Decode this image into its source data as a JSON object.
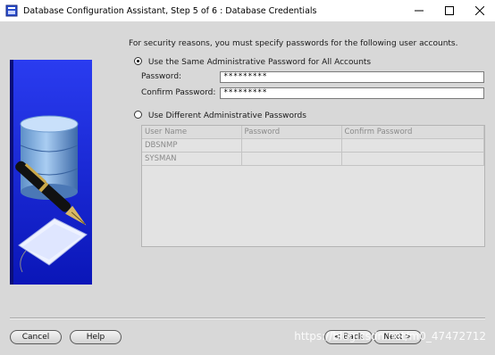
{
  "window": {
    "title": "Database Configuration Assistant, Step 5 of 6 : Database Credentials"
  },
  "content": {
    "intro": "For security reasons, you must specify passwords for the following user accounts.",
    "same_password_option": {
      "label": "Use the Same Administrative Password for All Accounts",
      "selected": true
    },
    "password_label": "Password:",
    "password_value": "*********",
    "confirm_label": "Confirm Password:",
    "confirm_value": "*********",
    "different_password_option": {
      "label": "Use Different Administrative Passwords",
      "selected": false
    },
    "table": {
      "columns": [
        "User Name",
        "Password",
        "Confirm Password"
      ],
      "rows": [
        [
          "DBSNMP",
          "",
          ""
        ],
        [
          "SYSMAN",
          "",
          ""
        ]
      ]
    }
  },
  "buttons": {
    "cancel": "Cancel",
    "help": "Help",
    "back": "< Back",
    "next": "Next >"
  },
  "watermark": "https://blog.csdn.net/m0_47472712",
  "colors": {
    "panel_blue": "#1a2ee0",
    "background": "#d8d8d8"
  }
}
